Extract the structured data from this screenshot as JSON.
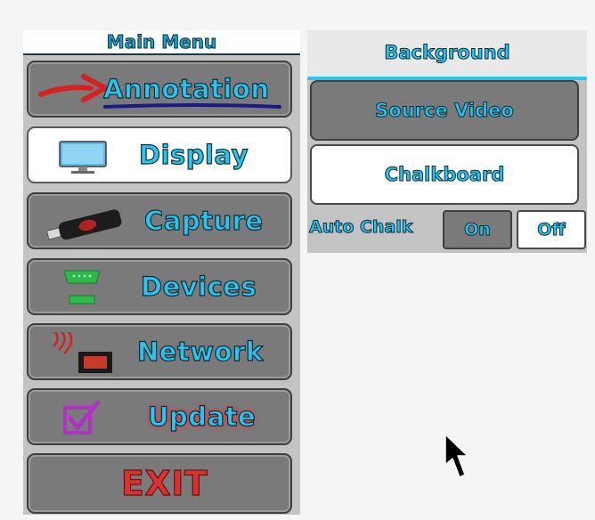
{
  "menu": {
    "header": "Main Menu",
    "items": [
      {
        "label": "Annotation",
        "icon": "red-arrow-icon",
        "active": false
      },
      {
        "label": "Display",
        "icon": "monitor-icon",
        "active": true
      },
      {
        "label": "Capture",
        "icon": "usb-drive-icon",
        "active": false
      },
      {
        "label": "Devices",
        "icon": "serial-port-icon",
        "active": false
      },
      {
        "label": "Network",
        "icon": "network-port-icon",
        "active": false
      },
      {
        "label": "Update",
        "icon": "checkbox-icon",
        "active": false
      },
      {
        "label": "EXIT",
        "icon": "",
        "active": false
      }
    ]
  },
  "background": {
    "title": "Background",
    "options": [
      {
        "label": "Source Video",
        "selected": false
      },
      {
        "label": "Chalkboard",
        "selected": true
      }
    ],
    "auto_chalk": {
      "label": "Auto Chalk",
      "on_label": "On",
      "off_label": "Off",
      "value": "Off"
    }
  },
  "colors": {
    "accent": "#28c6ee",
    "exit": "#d93030",
    "button_gray": "#7a7a7a",
    "panel_gray": "#c3c3c3"
  }
}
